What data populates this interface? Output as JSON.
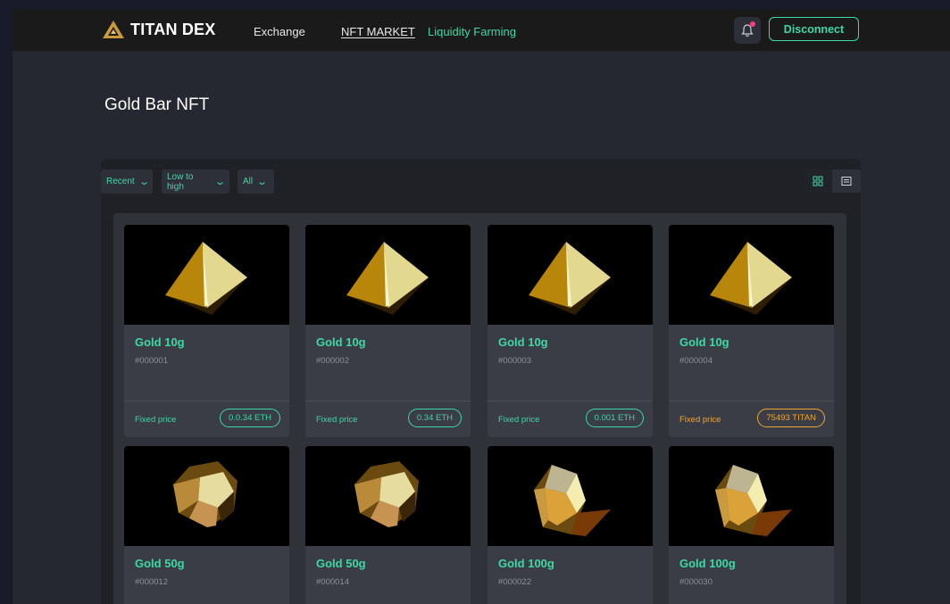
{
  "nav": {
    "brand": "TITAN DEX",
    "links": [
      "Exchange",
      "NFT MARKET",
      "Liquidity Farming"
    ],
    "disconnect": "Disconnect"
  },
  "page_title": "Gold Bar NFT",
  "filters": {
    "sort": "Recent",
    "order": "Low to high",
    "type": "All"
  },
  "colors": {
    "accent": "#3ed8a5",
    "orange": "#f0a530",
    "background": "#262831"
  },
  "cards": [
    {
      "name": "Gold 10g",
      "id": "#000001",
      "price_label": "Fixed price",
      "price": "0.0.34 ETH",
      "shape": "pyramid"
    },
    {
      "name": "Gold 10g",
      "id": "#000002",
      "price_label": "Fixed price",
      "price": "0.34 ETH",
      "shape": "pyramid"
    },
    {
      "name": "Gold 10g",
      "id": "#000003",
      "price_label": "Fixed price",
      "price": "0.001 ETH",
      "shape": "pyramid"
    },
    {
      "name": "Gold 10g",
      "id": "#000004",
      "price_label": "Fixed price",
      "price": "75493 TITAN",
      "shape": "pyramid"
    },
    {
      "name": "Gold 50g",
      "id": "#000012",
      "shape": "dodecahedron"
    },
    {
      "name": "Gold 50g",
      "id": "#000014",
      "shape": "dodecahedron"
    },
    {
      "name": "Gold 100g",
      "id": "#000022",
      "shape": "crystal"
    },
    {
      "name": "Gold 100g",
      "id": "#000030",
      "shape": "crystal"
    }
  ]
}
